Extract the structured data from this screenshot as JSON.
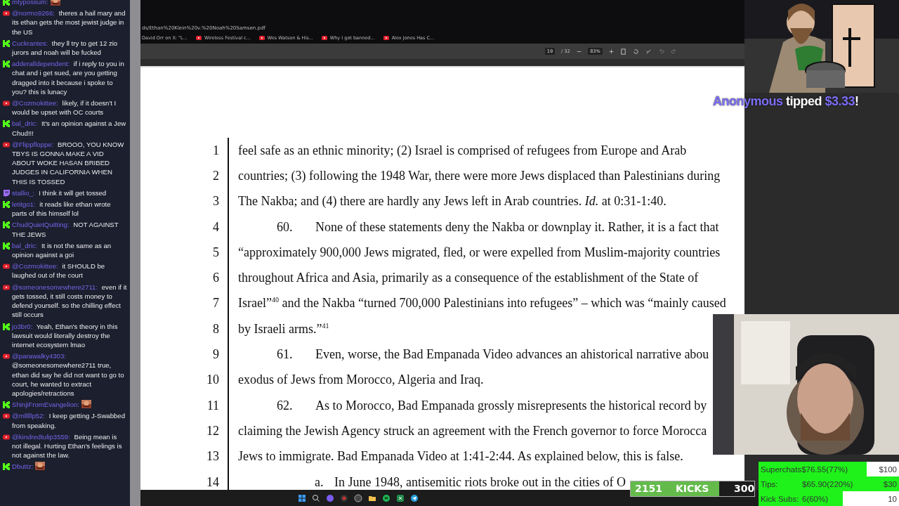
{
  "chat": {
    "messages": [
      {
        "kind": "kick",
        "user": "mtypossum:",
        "emote": true
      },
      {
        "kind": "youtube",
        "user": "@normo9266:",
        "text": "theres a hail mary and its ethan gets the most jewist judge in the US",
        "emote": false
      },
      {
        "kind": "kick",
        "user": "Cuckrantes:",
        "text": "they ll try to get 12 zio jurors and noah will be fucked",
        "emote": false
      },
      {
        "kind": "kick",
        "user": "adderalldependent:",
        "text": "if i reply to you in chat and i get sued, are you getting dragged into it because i spoke to you? this is lunacy",
        "emote": false
      },
      {
        "kind": "youtube",
        "user": "@Cozmokittee:",
        "text": "likely, if it doesn't I would be upset with OC courts",
        "emote": false
      },
      {
        "kind": "kick",
        "user": "bal_dric:",
        "text": "It's an opinion against a Jew Chud!!!",
        "emote": false
      },
      {
        "kind": "youtube",
        "user": "@Flippfloppe:",
        "text": "BROOO, YOU KNOW TBYS IS GONNA MAKE A VID ABOUT WOKE HASAN BRIBED JUDGES IN CALIFORNIA WHEN THIS IS TOSSED",
        "emote": false
      },
      {
        "kind": "twitch",
        "user": "stallio_:",
        "text": "I think it will get tossed",
        "emote": false
      },
      {
        "kind": "kick",
        "user": "letitgo1:",
        "text": "it reads like ethan wrote parts of this himself lol",
        "emote": false
      },
      {
        "kind": "kick",
        "user": "ChudQuietQuitting:",
        "text": "NOT AGAINST THE JEWS",
        "emote": false
      },
      {
        "kind": "kick",
        "user": "bal_dric:",
        "text": "It is not the same as an opinion against a goi",
        "emote": false
      },
      {
        "kind": "youtube",
        "user": "@Cozmokittee:",
        "text": "it SHOULD be laughed out of the court",
        "emote": false
      },
      {
        "kind": "youtube",
        "user": "@someonesomewhere2711:",
        "text": "even if it gets tossed, it still costs money to defend yourself. so the chilling effect still occurs",
        "emote": false
      },
      {
        "kind": "kick",
        "user": "jo3br0:",
        "text": "Yeah, Ethan's theory in this lawsuit would literally destroy the internet ecosystem lmao",
        "emote": false
      },
      {
        "kind": "youtube",
        "user": "@parawalky4303:",
        "text": "@someonesomewhere2711 true, ethan did say he did not want to go to court, he wanted to extract apologies/retractions",
        "emote": false
      },
      {
        "kind": "kick",
        "user": "ShinjiFromEvangelion:",
        "emote": true
      },
      {
        "kind": "youtube",
        "user": "@mlllllp52:",
        "text": "I keep getting J-Swabbed from speaking.",
        "emote": false
      },
      {
        "kind": "youtube",
        "user": "@kindredtulip3559:",
        "text": "Being mean is not illegal. Hurting Ethan's feelings is not against the law.",
        "emote": false
      },
      {
        "kind": "kick",
        "user": "Dbuttz:",
        "emote": true
      }
    ]
  },
  "browser": {
    "address": "ds/Ethan%20Klein%20v.%20Noah%20Samsen.pdf",
    "bookmarks": [
      {
        "label": "David Orr on X: \"L...",
        "kind": "x"
      },
      {
        "label": "Wireless Festival c...",
        "kind": "youtube"
      },
      {
        "label": "Wes Watson & His...",
        "kind": "youtube"
      },
      {
        "label": "Why I got banned...",
        "kind": "youtube"
      },
      {
        "label": "Alex Jones Has C...",
        "kind": "youtube"
      }
    ]
  },
  "pdf_toolbar": {
    "page": "19",
    "page_count": "/ 32",
    "zoom_out": "−",
    "zoom": "83%",
    "zoom_in": "+"
  },
  "document": {
    "lines": [
      {
        "number": "1",
        "kind": "plain",
        "text": "feel safe as an ethnic minority; (2) Israel is comprised of refugees from Europe and Arab"
      },
      {
        "number": "2",
        "kind": "plain",
        "text": "countries; (3) following the 1948 War, there were more Jews displaced than Palestinians during"
      },
      {
        "number": "3",
        "kind": "plain",
        "text": "The Nakba; and (4) there are hardly any Jews left in Arab countries. *Id.* at 0:31-1:40."
      },
      {
        "number": "4",
        "kind": "paragraph",
        "marker": "60.",
        "text": "None of these statements deny the Nakba or downplay it. Rather, it is a fact that"
      },
      {
        "number": "5",
        "kind": "plain",
        "text": "“approximately 900,000 Jews migrated, fled, or were expelled from Muslim-majority countries"
      },
      {
        "number": "6",
        "kind": "plain",
        "text": "throughout Africa and Asia, primarily as a consequence of the establishment of the State of"
      },
      {
        "number": "7",
        "kind": "plain",
        "text": "Israel”$^{40}$ and the Nakba “turned 700,000 Palestinians into refugees” – which was “mainly caused"
      },
      {
        "number": "8",
        "kind": "plain",
        "text": "by Israeli arms.”$^{41}$"
      },
      {
        "number": "9",
        "kind": "paragraph",
        "marker": "61.",
        "text": "Even, worse, the Bad Empanada Video advances an ahistorical narrative abou"
      },
      {
        "number": "10",
        "kind": "plain",
        "text": "exodus of Jews from Morocco, Algeria and Iraq."
      },
      {
        "number": "11",
        "kind": "paragraph",
        "marker": "62.",
        "text": "As to Morocco, Bad Empanada grossly misrepresents the historical record by"
      },
      {
        "number": "12",
        "kind": "plain",
        "text": "claiming the Jewish Agency struck an agreement with the French governor to force Morocca"
      },
      {
        "number": "13",
        "kind": "plain",
        "text": "Jews to immigrate. Bad Empanada Video at 1:41-2:44. As explained below, this is false."
      },
      {
        "number": "14",
        "kind": "subparagraph",
        "marker": "a.",
        "text": "In June 1948, antisemitic riots broke out in the cities of O"
      }
    ]
  },
  "tip_alert": {
    "name": "Anonymous",
    "verb": "tipped",
    "amount": "$3.33",
    "end": "!"
  },
  "kicks_goal": {
    "count": "2151",
    "label": "KICKS",
    "target": "300",
    "level": 0.717
  },
  "goals": [
    {
      "label": "Superchats",
      "value": "$76.55(77%)",
      "target": "$100",
      "level": 0.77
    },
    {
      "label": "Tips:",
      "value": "$65.90(220%)",
      "target": "$30",
      "level": 1
    },
    {
      "label": "Kick Subs:",
      "value": "6(60%)",
      "target": "10",
      "level": 0.6
    }
  ]
}
